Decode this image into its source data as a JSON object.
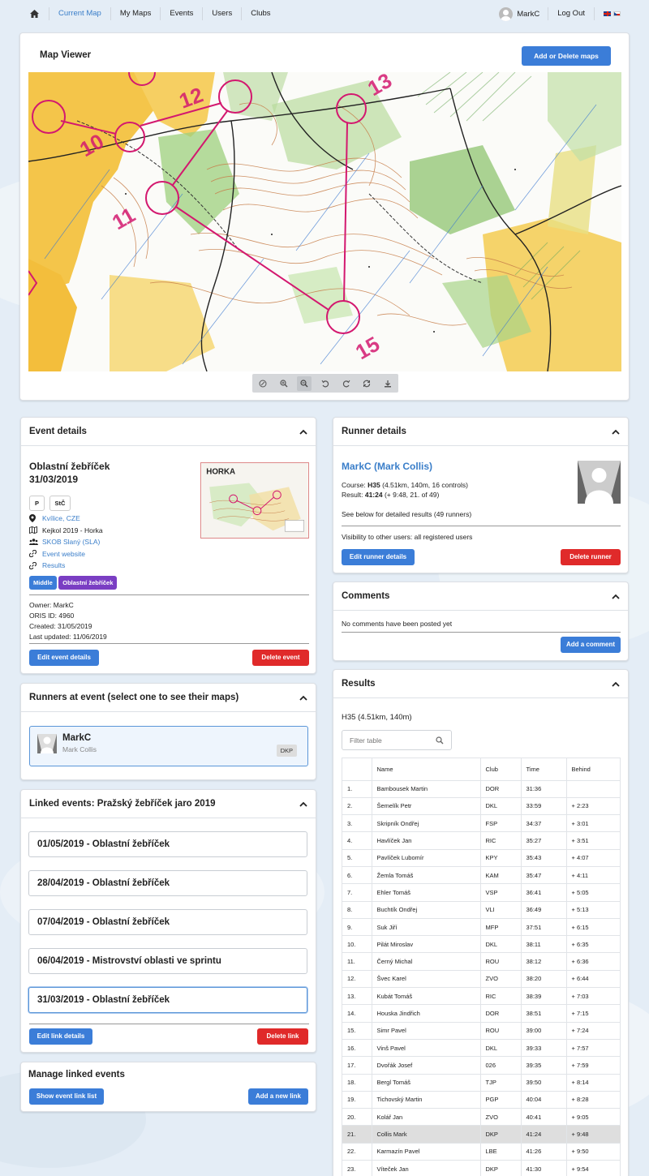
{
  "nav": {
    "items": [
      "Current Map",
      "My Maps",
      "Events",
      "Users",
      "Clubs"
    ],
    "user": "MarkC",
    "logout": "Log Out"
  },
  "map_viewer": {
    "title": "Map Viewer",
    "add_button": "Add or Delete maps",
    "map_labels": [
      "10",
      "11",
      "12",
      "13",
      "15"
    ]
  },
  "event": {
    "header": "Event details",
    "name": "Oblastní žebříček",
    "date": "31/03/2019",
    "tags": [
      "P",
      "StČ"
    ],
    "location": "Kvílice, CZE",
    "map": "Kejkol 2019 - Horka",
    "club": "SKOB Slaný (SLA)",
    "website": "Event website",
    "results": "Results",
    "badges": [
      "Middle",
      "Oblastní žebříček"
    ],
    "thumb_title": "HORKA",
    "owner": "Owner: MarkC",
    "oris": "ORIS ID: 4960",
    "created": "Created: 31/05/2019",
    "updated": "Last updated: 11/06/2019",
    "edit_button": "Edit event details",
    "delete_button": "Delete event"
  },
  "runners": {
    "header": "Runners at event (select one to see their maps)",
    "name": "MarkC",
    "full": "Mark Collis",
    "club": "DKP"
  },
  "linked": {
    "header": "Linked events: Pražský žebříček jaro 2019",
    "items": [
      "01/05/2019 - Oblastní žebříček",
      "28/04/2019 - Oblastní žebříček",
      "07/04/2019 - Oblastní žebříček",
      "06/04/2019 - Mistrovství oblasti ve sprintu",
      "31/03/2019 - Oblastní žebříček"
    ],
    "edit_button": "Edit link details",
    "delete_button": "Delete link"
  },
  "manage": {
    "header": "Manage linked events",
    "show_button": "Show event link list",
    "add_button": "Add a new link"
  },
  "runner_details": {
    "header": "Runner details",
    "name": "MarkC (Mark Collis)",
    "course_label": "Course:",
    "course_value": "H35",
    "course_detail": "(4.51km, 140m, 16 controls)",
    "result_label": "Result:",
    "result_value": "41:24",
    "result_detail": "(+ 9:48, 21. of 49)",
    "see_below": "See below for detailed results (49 runners)",
    "visibility": "Visibility to other users: all registered users",
    "edit_button": "Edit runner details",
    "delete_button": "Delete runner"
  },
  "comments": {
    "header": "Comments",
    "empty": "No comments have been posted yet",
    "add_button": "Add a comment"
  },
  "results": {
    "header": "Results",
    "course": "H35 (4.51km, 140m)",
    "filter_placeholder": "Filter table",
    "columns": [
      "Name",
      "Club",
      "Time",
      "Behind"
    ],
    "rows": [
      [
        "1.",
        "Bambousek Martin",
        "DOR",
        "31:36",
        ""
      ],
      [
        "2.",
        "Šemelík Petr",
        "DKL",
        "33:59",
        "+ 2:23"
      ],
      [
        "3.",
        "Skripník Ondřej",
        "FSP",
        "34:37",
        "+ 3:01"
      ],
      [
        "4.",
        "Havlíček Jan",
        "RIC",
        "35:27",
        "+ 3:51"
      ],
      [
        "5.",
        "Pavlíček Lubomír",
        "KPY",
        "35:43",
        "+ 4:07"
      ],
      [
        "6.",
        "Žemla Tomáš",
        "KAM",
        "35:47",
        "+ 4:11"
      ],
      [
        "7.",
        "Ehler Tomáš",
        "VSP",
        "36:41",
        "+ 5:05"
      ],
      [
        "8.",
        "Buchtík Ondřej",
        "VLI",
        "36:49",
        "+ 5:13"
      ],
      [
        "9.",
        "Suk Jiří",
        "MFP",
        "37:51",
        "+ 6:15"
      ],
      [
        "10.",
        "Pilát Miroslav",
        "DKL",
        "38:11",
        "+ 6:35"
      ],
      [
        "11.",
        "Černý Michal",
        "ROU",
        "38:12",
        "+ 6:36"
      ],
      [
        "12.",
        "Švec Karel",
        "ZVO",
        "38:20",
        "+ 6:44"
      ],
      [
        "13.",
        "Kubát Tomáš",
        "RIC",
        "38:39",
        "+ 7:03"
      ],
      [
        "14.",
        "Houska Jindřich",
        "DOR",
        "38:51",
        "+ 7:15"
      ],
      [
        "15.",
        "Simr Pavel",
        "ROU",
        "39:00",
        "+ 7:24"
      ],
      [
        "16.",
        "Vinš Pavel",
        "DKL",
        "39:33",
        "+ 7:57"
      ],
      [
        "17.",
        "Dvořák Josef",
        "026",
        "39:35",
        "+ 7:59"
      ],
      [
        "18.",
        "Bergl Tomáš",
        "TJP",
        "39:50",
        "+ 8:14"
      ],
      [
        "19.",
        "Tichovský Martin",
        "PGP",
        "40:04",
        "+ 8:28"
      ],
      [
        "20.",
        "Kolář Jan",
        "ZVO",
        "40:41",
        "+ 9:05"
      ],
      [
        "21.",
        "Collis Mark",
        "DKP",
        "41:24",
        "+ 9:48"
      ],
      [
        "22.",
        "Karmazín Pavel",
        "LBE",
        "41:26",
        "+ 9:50"
      ],
      [
        "23.",
        "Víteček Jan",
        "DKP",
        "41:30",
        "+ 9:54"
      ]
    ],
    "highlight_index": 20
  }
}
